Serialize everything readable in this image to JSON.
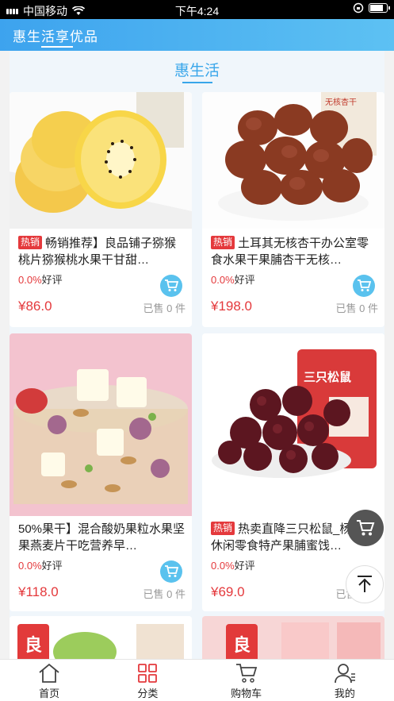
{
  "status_bar": {
    "carrier": "中国移动",
    "time": "下午4:24"
  },
  "header": {
    "title": "惠生活享优品"
  },
  "section": {
    "title": "惠生活"
  },
  "products": [
    {
      "tag": "热销",
      "name": "畅销推荐】良品铺子猕猴桃片猕猴桃水果干甘甜…",
      "rating_pct": "0.0%",
      "rating_label": "好评",
      "price": "¥86.0",
      "sold": "已售 0 件",
      "image_label": ""
    },
    {
      "tag": "热销",
      "name": "土耳其无核杏干办公室零食水果干果脯杏干无核…",
      "rating_pct": "0.0%",
      "rating_label": "好评",
      "price": "¥198.0",
      "sold": "已售 0 件",
      "image_label": "无核杏干"
    },
    {
      "tag": "",
      "name": "50%果干】混合酸奶果粒水果坚果燕麦片干吃营养早…",
      "rating_pct": "0.0%",
      "rating_label": "好评",
      "price": "¥118.0",
      "sold": "已售 0 件",
      "image_label": ""
    },
    {
      "tag": "热销",
      "name": "热卖直降三只松鼠_杨梅干休闲零食特产果脯蜜饯…",
      "rating_pct": "0.0%",
      "rating_label": "好评",
      "price": "¥69.0",
      "sold": "已售 0 件",
      "image_label": "三只松鼠"
    }
  ],
  "tabs": [
    {
      "label": "首页",
      "icon": "home-icon"
    },
    {
      "label": "分类",
      "icon": "grid-icon"
    },
    {
      "label": "购物车",
      "icon": "cart-icon"
    },
    {
      "label": "我的",
      "icon": "user-icon"
    }
  ],
  "colors": {
    "accent": "#39a6ea",
    "price": "#e4393c",
    "header_start": "#3da3ee",
    "header_end": "#5dc1f3"
  }
}
